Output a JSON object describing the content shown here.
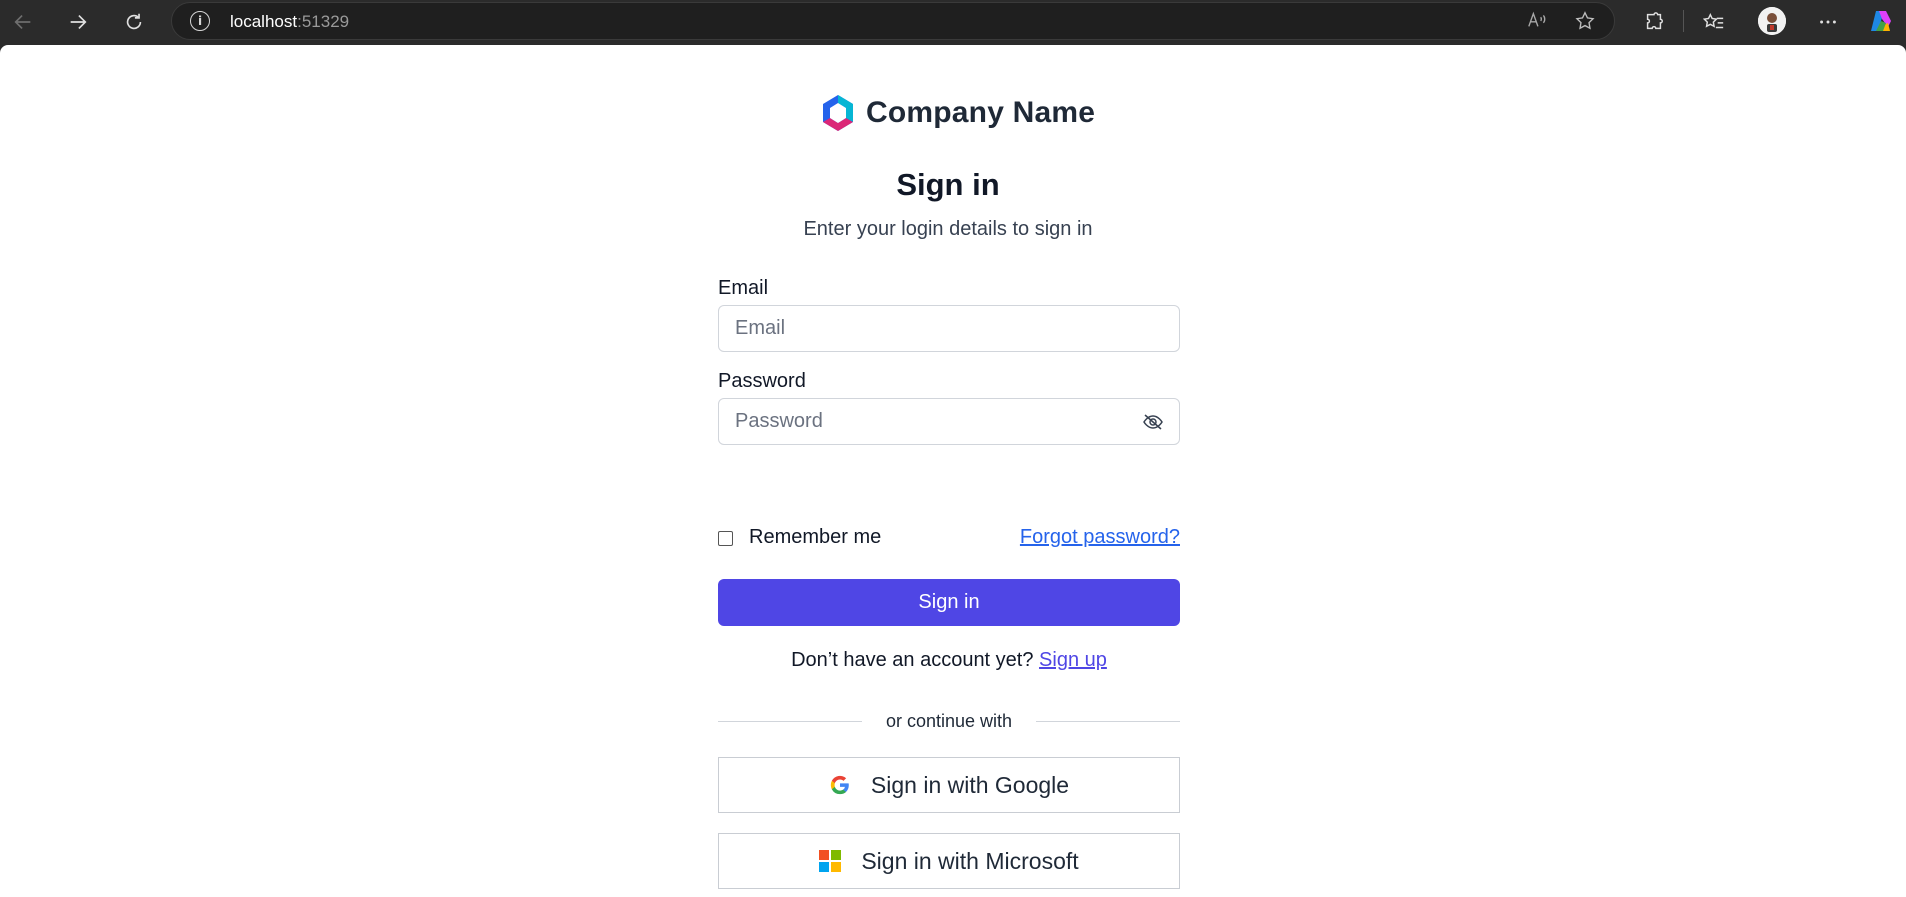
{
  "browser": {
    "url_host": "localhost",
    "url_port": ":51329",
    "read_aloud_label": "Aᵀ"
  },
  "brand": {
    "name": "Company Name"
  },
  "signin": {
    "title": "Sign in",
    "subtitle": "Enter your login details to sign in",
    "email_label": "Email",
    "email_placeholder": "Email",
    "password_label": "Password",
    "password_placeholder": "Password",
    "remember_label": "Remember me",
    "forgot_label": "Forgot password?",
    "submit_label": "Sign in",
    "no_account_text": "Don’t have an account yet? ",
    "signup_label": "Sign up",
    "divider_text": "or continue with",
    "google_label": "Sign in with Google",
    "microsoft_label": "Sign in with Microsoft"
  },
  "colors": {
    "primary": "#4f46e5",
    "link": "#2563eb"
  },
  "icons": [
    "back-arrow-icon",
    "forward-arrow-icon",
    "refresh-icon",
    "info-icon",
    "read-aloud-icon",
    "favorite-star-icon",
    "extensions-icon",
    "favorites-icon",
    "profile-avatar",
    "more-icon",
    "copilot-icon",
    "company-logo-icon",
    "eye-off-icon",
    "google-icon",
    "microsoft-icon"
  ]
}
